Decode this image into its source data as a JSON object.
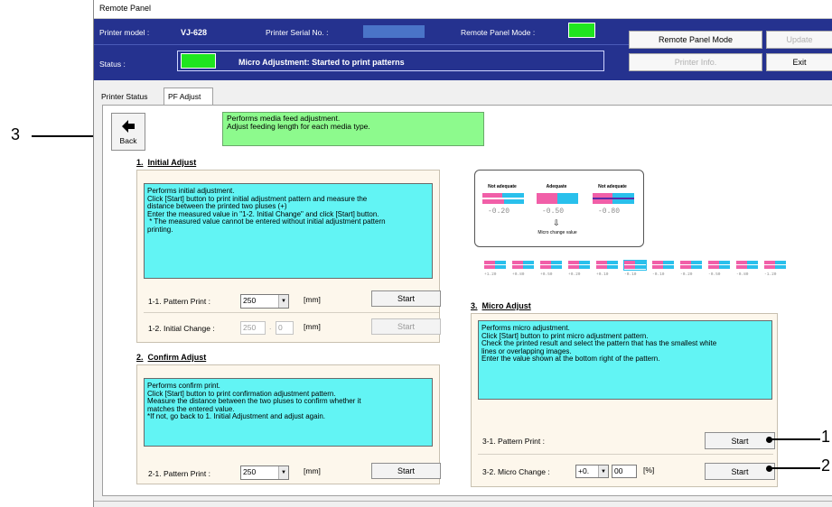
{
  "window": {
    "title": "Remote Panel"
  },
  "header": {
    "printer_model_label": "Printer model :",
    "printer_model_value": "VJ-628",
    "serial_label": "Printer Serial No. :",
    "remote_mode_label": "Remote Panel Mode :",
    "status_label": "Status :",
    "status_text": "Micro Adjustment: Started to print patterns",
    "buttons": {
      "remote_panel_mode": "Remote Panel Mode",
      "update": "Update",
      "printer_info": "Printer Info.",
      "exit": "Exit"
    }
  },
  "tabs": [
    {
      "label": "Printer Status"
    },
    {
      "label": "PF Adjust",
      "selected": true
    }
  ],
  "back": {
    "label": "Back"
  },
  "info": {
    "line1": "Performs media feed adjustment.",
    "line2": "Adjust feeding length for each media type."
  },
  "initial": {
    "num": "1.",
    "title": "Initial Adjust",
    "desc": "Performs initial adjustment.\nClick [Start] button to print initial adjustment pattern and measure the\ndistance between the printed two pluses (+)\nEnter the measured value in \"1-2. Initial Change\" and click [Start] button.\n * The measured value cannot be entered without initial adjustment pattern\nprinting.",
    "row1": {
      "label": "1-1.  Pattern Print    :",
      "value": "250",
      "unit": "[mm]",
      "button": "Start"
    },
    "row2": {
      "label": "1-2.  Initial Change  :",
      "value_int": "250",
      "dot": ".",
      "value_dec": "0",
      "unit": "[mm]",
      "button": "Start"
    }
  },
  "confirm": {
    "num": "2.",
    "title": "Confirm Adjust",
    "desc": "Performs confirm print.\nClick [Start] button to print confirmation adjustment pattern.\nMeasure the distance between the two pluses to confirm whether it\nmatches the entered value.\n*If not, go back to 1. Initial Adjustment and adjust again.",
    "row1": {
      "label": "2-1.  Pattern Print    :",
      "value": "250",
      "unit": "[mm]",
      "button": "Start"
    }
  },
  "diagram": {
    "labels": [
      "Not adequate",
      "Adequate",
      "Not adequate"
    ],
    "values": [
      "-0.20",
      "-0.50",
      "-0.80"
    ],
    "caption": "Micro change value",
    "scale": [
      "+1.20",
      "+0.80",
      "+0.50",
      "+0.20",
      "+0.10",
      "-0.10",
      "-0.10",
      "-0.20",
      "-0.50",
      "-0.80",
      "-1.20"
    ]
  },
  "micro": {
    "num": "3.",
    "title": "Micro Adjust",
    "desc": "Performs micro adjustment.\nClick [Start] button to print micro adjustment pattern.\nCheck the printed result and select the pattern that has the smallest white\nlines or overlapping images.\nEnter the value shown at the bottom right of the pattern.",
    "row1": {
      "label": "3-1.  Pattern Print    :",
      "button": "Start"
    },
    "row2": {
      "label": "3-2.  Micro Change  :",
      "sign_value": "+0.",
      "value_dec": "00",
      "unit": "[%]",
      "button": "Start"
    }
  },
  "callouts": {
    "c1": "1",
    "c2": "2",
    "c3": "3"
  },
  "colors": {
    "header_bg": "#25328f",
    "status_green": "#1fe51f",
    "info_green": "#8dfa8d",
    "desc_cyan": "#62f4f4",
    "pink": "#f15fa8",
    "blue": "#29c0ec"
  }
}
